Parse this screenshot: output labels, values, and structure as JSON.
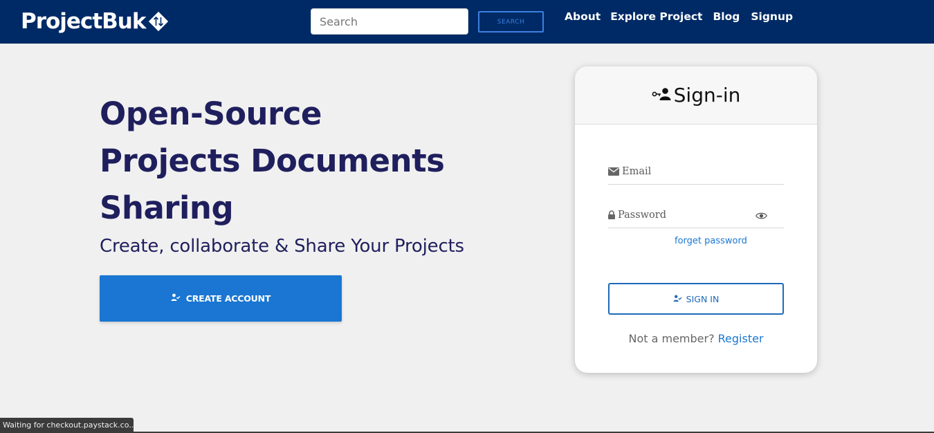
{
  "nav": {
    "brand": "ProjectBuk",
    "search": {
      "placeholder": "Search",
      "button": "SEARCH"
    },
    "links": [
      "About",
      "Explore Project",
      "Blog",
      "Signup"
    ]
  },
  "hero": {
    "title_lines": [
      "Open-Source",
      "Projects Documents",
      "Sharing"
    ],
    "subtitle": "Create, collaborate & Share Your Projects",
    "cta": "CREATE ACCOUNT"
  },
  "signin": {
    "title": "Sign-in",
    "email_placeholder": "Email",
    "password_placeholder": "Password",
    "forget": "forget password",
    "button": "SIGN IN",
    "not_member": "Not a member?",
    "register": "Register"
  },
  "status_bar": "Waiting for checkout.paystack.co...",
  "colors": {
    "navbar": "#002a66",
    "primary": "#1a76d2",
    "heading": "#1f1f5e",
    "background": "#f0f0f0"
  },
  "icons": {
    "brand": "diamond-arrows-icon",
    "signin_header": "user-key-icon",
    "email": "envelope-icon",
    "password": "lock-icon",
    "toggle_password": "eye-icon",
    "create_account": "user-check-icon",
    "signin_button": "user-check-icon"
  }
}
